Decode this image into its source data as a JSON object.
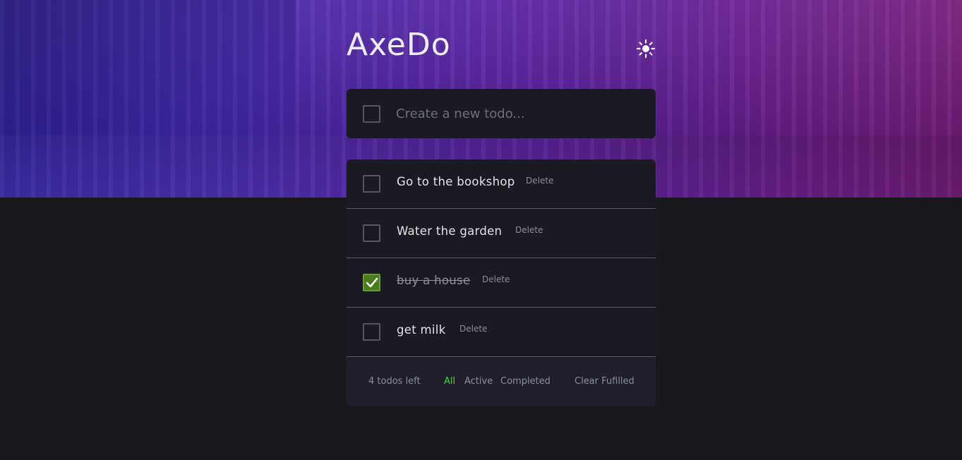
{
  "app": {
    "title": "AxeDo"
  },
  "icons": {
    "theme_toggle": "sun-icon",
    "check": "check-icon"
  },
  "colors": {
    "accent_active": "#3fdc3f",
    "checked_box": "#4b7a1e",
    "card_bg": "#1a1b22",
    "page_bg": "#18191c"
  },
  "new_todo": {
    "placeholder": "Create a new todo..."
  },
  "todos": [
    {
      "text": "Go to the bookshop",
      "completed": false,
      "delete_label": "Delete"
    },
    {
      "text": "Water the garden",
      "completed": false,
      "delete_label": "Delete"
    },
    {
      "text": "buy a house",
      "completed": true,
      "delete_label": "Delete"
    },
    {
      "text": "get milk",
      "completed": false,
      "delete_label": "Delete"
    }
  ],
  "footer": {
    "items_left": "4 todos left",
    "filters": [
      "All",
      "Active",
      "Completed"
    ],
    "active_filter": "All",
    "clear_label": "Clear Fufilled"
  }
}
